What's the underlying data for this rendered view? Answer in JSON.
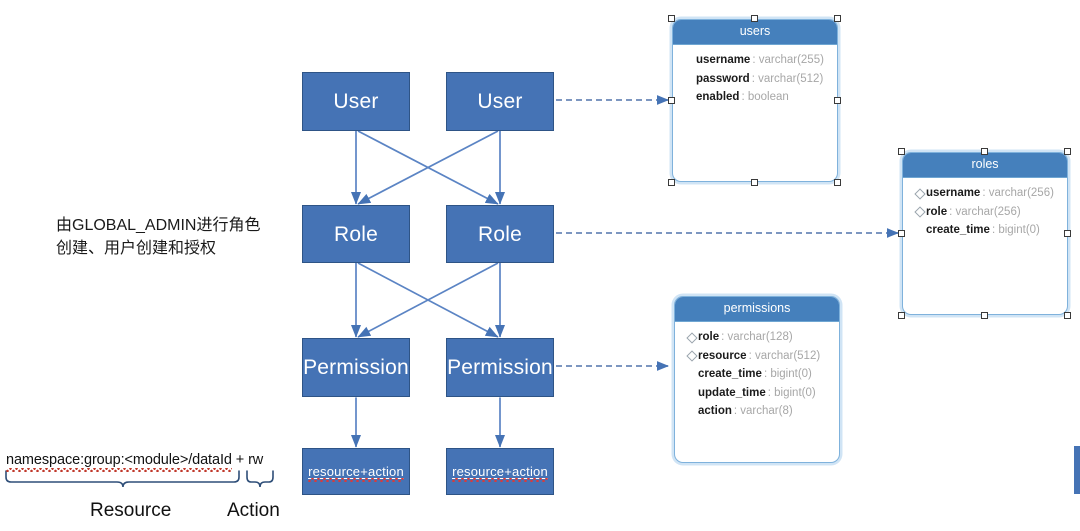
{
  "diagram": {
    "title_note": "由GLOBAL_ADMIN进行角色创建、用户创建和授权",
    "colors": {
      "box_fill": "#4573B5",
      "box_stroke": "#2E5486",
      "table_header": "#4580BC",
      "table_border": "#7FB2DC",
      "connector": "#5B84C4",
      "dashed_connector": "#6A87B8",
      "spell_underline": "#D83B3B"
    }
  },
  "flow": {
    "nodes": [
      {
        "id": "user-left",
        "label": "User"
      },
      {
        "id": "user-right",
        "label": "User"
      },
      {
        "id": "role-left",
        "label": "Role"
      },
      {
        "id": "role-right",
        "label": "Role"
      },
      {
        "id": "permission-left",
        "label": "Permission"
      },
      {
        "id": "permission-right",
        "label": "Permission"
      },
      {
        "id": "ra-left",
        "label": "resource+action"
      },
      {
        "id": "ra-right",
        "label": "resource+action"
      }
    ]
  },
  "tables": [
    {
      "id": "users",
      "name": "users",
      "selected": true,
      "columns": [
        {
          "key": false,
          "name": "username",
          "type": "varchar(255)"
        },
        {
          "key": false,
          "name": "password",
          "type": "varchar(512)"
        },
        {
          "key": false,
          "name": "enabled",
          "type": "boolean"
        }
      ]
    },
    {
      "id": "roles",
      "name": "roles",
      "selected": true,
      "columns": [
        {
          "key": true,
          "name": "username",
          "type": "varchar(256)"
        },
        {
          "key": true,
          "name": "role",
          "type": "varchar(256)"
        },
        {
          "key": false,
          "name": "create_time",
          "type": "bigint(0)"
        }
      ]
    },
    {
      "id": "permissions",
      "name": "permissions",
      "selected": false,
      "columns": [
        {
          "key": true,
          "name": "role",
          "type": "varchar(128)"
        },
        {
          "key": true,
          "name": "resource",
          "type": "varchar(512)"
        },
        {
          "key": false,
          "name": "create_time",
          "type": "bigint(0)"
        },
        {
          "key": false,
          "name": "update_time",
          "type": "bigint(0)"
        },
        {
          "key": false,
          "name": "action",
          "type": "varchar(8)"
        }
      ]
    }
  ],
  "legend": {
    "permission_string": {
      "resource_part": "namespace:group:<module>/dataId",
      "separator": " + ",
      "action_part": "rw",
      "full": "namespace:group:<module>/dataId + rw"
    },
    "brace_labels": {
      "resource": "Resource",
      "action": "Action"
    }
  }
}
